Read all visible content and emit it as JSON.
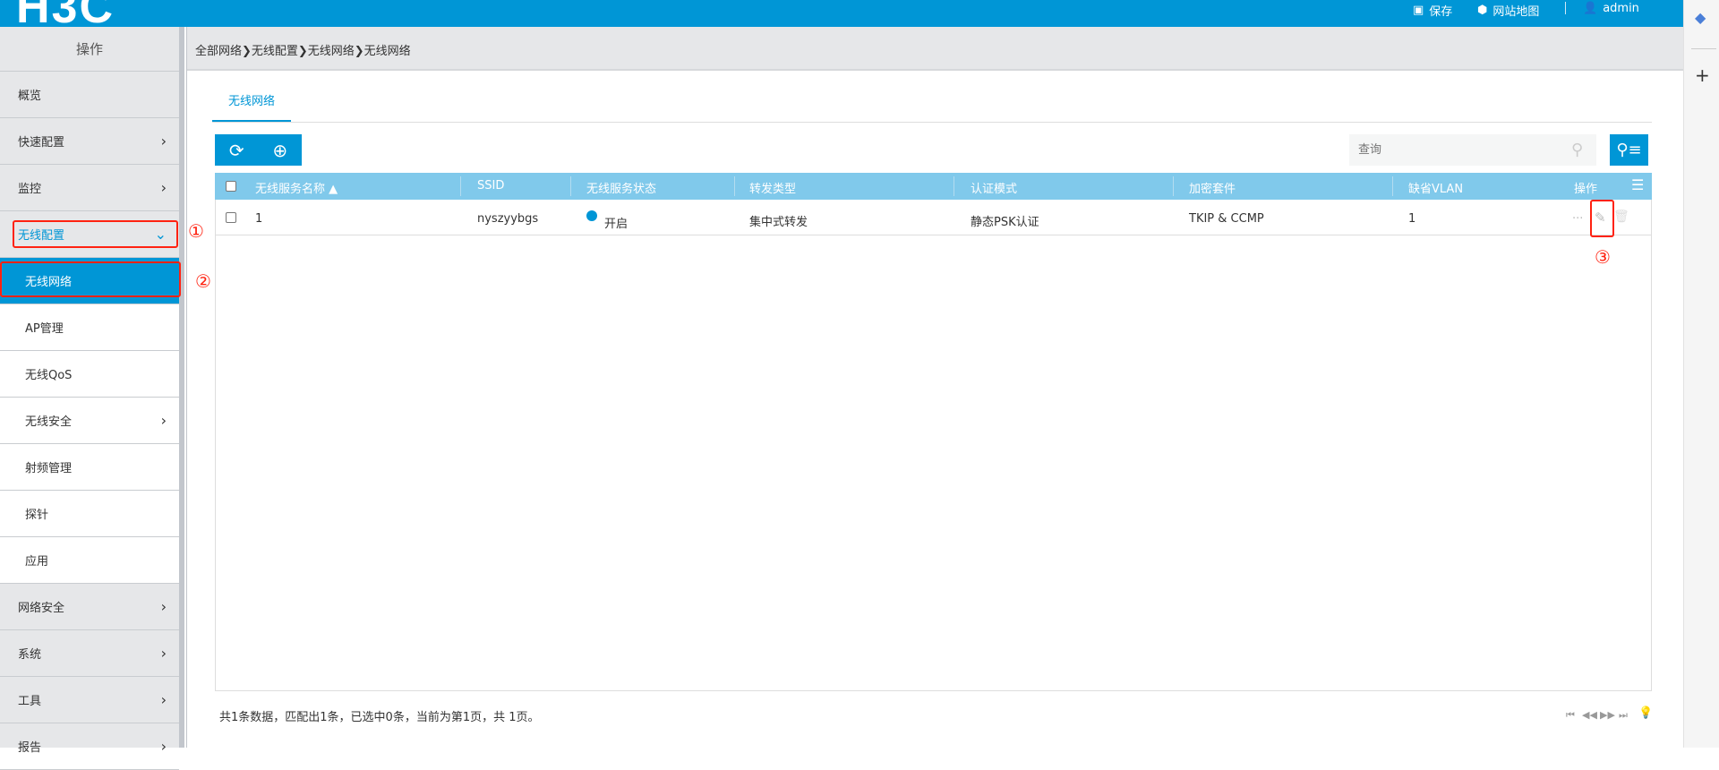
{
  "header": {
    "logo": "H3C",
    "save": "保存",
    "sitemap": "网站地图",
    "user": "admin"
  },
  "sidebar": {
    "title": "操作",
    "items": [
      {
        "label": "概览"
      },
      {
        "label": "快速配置"
      },
      {
        "label": "监控"
      },
      {
        "label": "无线配置"
      },
      {
        "label": "无线网络"
      },
      {
        "label": "AP管理"
      },
      {
        "label": "无线QoS"
      },
      {
        "label": "无线安全"
      },
      {
        "label": "射频管理"
      },
      {
        "label": "探针"
      },
      {
        "label": "应用"
      },
      {
        "label": "网络安全"
      },
      {
        "label": "系统"
      },
      {
        "label": "工具"
      },
      {
        "label": "报告"
      }
    ]
  },
  "breadcrumb": "全部网络❯无线配置❯无线网络❯无线网络",
  "tab": "无线网络",
  "search": {
    "placeholder": "查询"
  },
  "table": {
    "columns": [
      "无线服务名称 ▲",
      "SSID",
      "无线服务状态",
      "转发类型",
      "认证模式",
      "加密套件",
      "缺省VLAN",
      "操作"
    ],
    "rows": [
      {
        "name": "1",
        "ssid": "nyszyybgs",
        "status": "开启",
        "forward": "集中式转发",
        "auth": "静态PSK认证",
        "cipher": "TKIP & CCMP",
        "vlan": "1"
      }
    ]
  },
  "footer": "共1条数据，匹配出1条，已选中0条，当前为第1页，共 1页。",
  "annotations": [
    "①",
    "②",
    "③"
  ],
  "colors": {
    "brand": "#0096d6",
    "table_header": "#80c9eb",
    "annotation": "#ff2211"
  }
}
